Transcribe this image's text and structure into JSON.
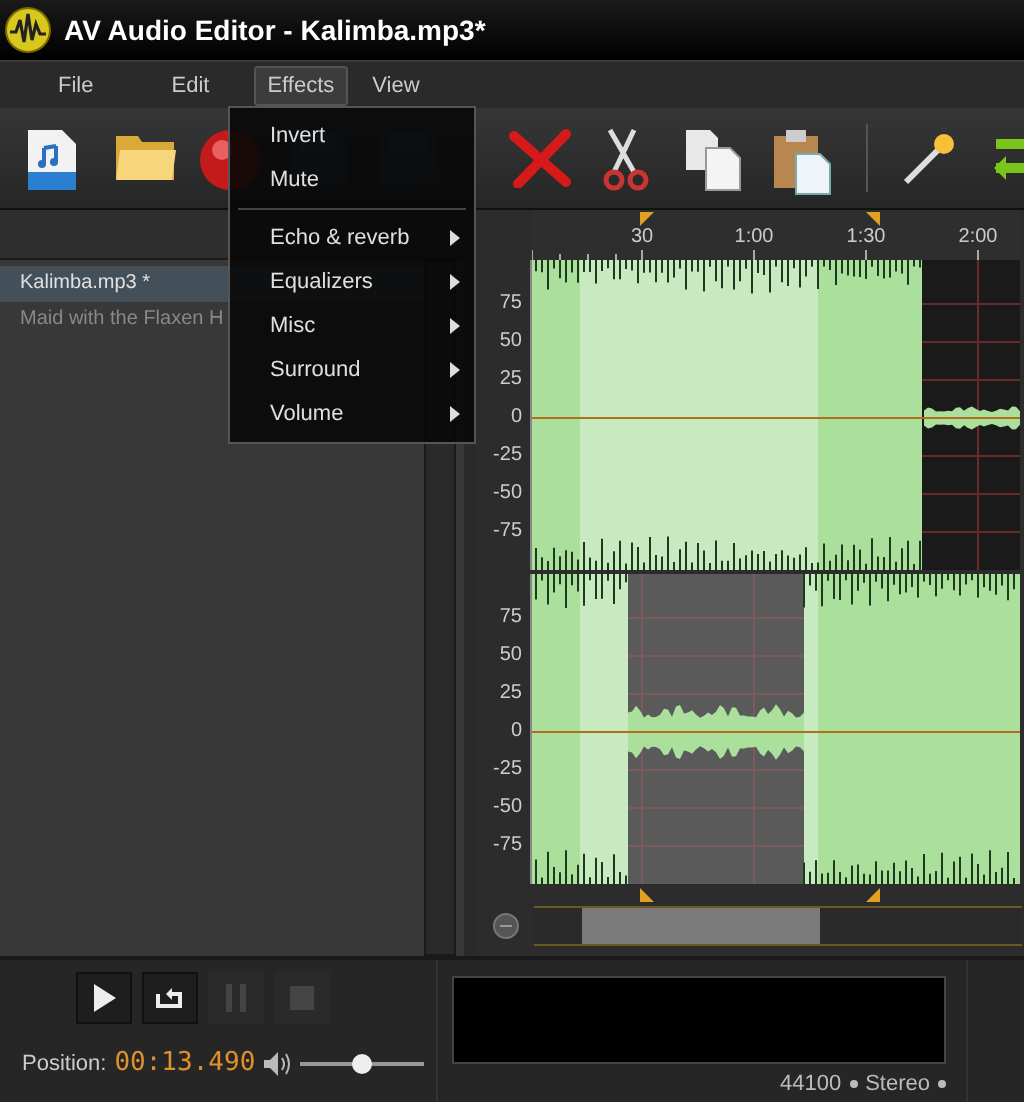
{
  "window": {
    "title": "AV Audio Editor - Kalimba.mp3*"
  },
  "menu": [
    {
      "label": "File",
      "selected": false
    },
    {
      "label": "Edit",
      "selected": false
    },
    {
      "label": "Effects",
      "selected": true
    },
    {
      "label": "View",
      "selected": false
    }
  ],
  "dropdown": [
    {
      "kind": "command",
      "label": "Invert"
    },
    {
      "kind": "command",
      "label": "Mute"
    },
    {
      "kind": "separator"
    },
    {
      "kind": "submenu",
      "label": "Echo & reverb"
    },
    {
      "kind": "submenu",
      "label": "Equalizers"
    },
    {
      "kind": "submenu",
      "label": "Misc"
    },
    {
      "kind": "submenu",
      "label": "Surround"
    },
    {
      "kind": "submenu",
      "label": "Volume"
    }
  ],
  "files": [
    {
      "name": "Kalimba.mp3 *",
      "selected": true
    },
    {
      "name": "Maid with the Flaxen H",
      "selected": false
    }
  ],
  "ruler": [
    "30",
    "1:00",
    "1:30",
    "2:00"
  ],
  "channels": [
    {
      "scale": [
        "75",
        "50",
        "25",
        "0",
        "-25",
        "-50",
        "-75"
      ]
    },
    {
      "scale": [
        "75",
        "50",
        "25",
        "0",
        "-25",
        "-50",
        "-75"
      ]
    }
  ],
  "transport": [
    {
      "kind": "play",
      "disabled": false
    },
    {
      "kind": "loop",
      "disabled": false
    },
    {
      "kind": "pause",
      "disabled": true
    },
    {
      "kind": "stop",
      "disabled": true
    }
  ],
  "position": {
    "label": "Position:",
    "value": "00:13.490"
  },
  "volume": {
    "level": 0.5
  },
  "format": {
    "sample_rate": "44100",
    "channels": "Stereo"
  }
}
